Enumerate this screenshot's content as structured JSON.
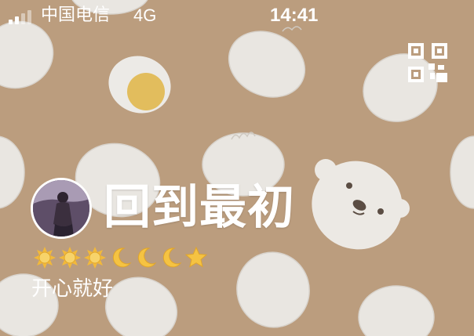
{
  "status_bar": {
    "carrier": "中国电信",
    "network": "4G",
    "time": "14:41",
    "signal_bars_filled": 2,
    "signal_bars_total": 4
  },
  "profile": {
    "nickname": "回到最初",
    "signature": "开心就好",
    "level_icons": [
      "sun-icon",
      "sun-icon",
      "sun-icon",
      "moon-icon",
      "moon-icon",
      "moon-icon",
      "star-icon"
    ]
  },
  "header": {
    "qr_icon": "qr-code-icon"
  },
  "colors": {
    "background": "#bb9d7e",
    "pattern": "#e9e6e1",
    "egg_yolk": "#e2bd5d",
    "sun": "#f2b93a",
    "moon": "#f5c342",
    "star": "#f5c342",
    "text": "#ffffff"
  }
}
